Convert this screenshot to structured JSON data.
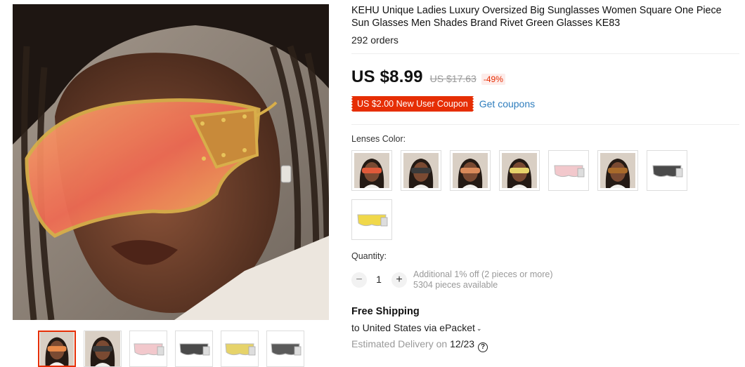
{
  "product": {
    "title": "KEHU Unique Ladies Luxury Oversized Big Sunglasses Women Square One Piece Sun Glasses Men Shades Brand Rivet Green Glasses KE83",
    "orders": "292 orders"
  },
  "price": {
    "current": "US $8.99",
    "original": "US $17.63",
    "discount": "-49%"
  },
  "coupon": {
    "label": "US $2.00 New User Coupon",
    "link": "Get coupons"
  },
  "lenses": {
    "label": "Lenses Color:",
    "options": [
      {
        "kind": "model",
        "lens": "#e05a3a"
      },
      {
        "kind": "model",
        "lens": "#3a3a3a"
      },
      {
        "kind": "model",
        "lens": "#d98a5a"
      },
      {
        "kind": "model",
        "lens": "#e6d36a"
      },
      {
        "kind": "product",
        "lens": "#f2c8cc"
      },
      {
        "kind": "model",
        "lens": "#a86a2a"
      },
      {
        "kind": "product",
        "lens": "#4a4a4a"
      },
      {
        "kind": "product",
        "lens": "#f0d84a"
      }
    ]
  },
  "quantity": {
    "label": "Quantity:",
    "value": "1",
    "minus": "−",
    "plus": "+",
    "note_line1": "Additional 1% off (2 pieces or more)",
    "note_line2": "5304 pieces available"
  },
  "shipping": {
    "title": "Free Shipping",
    "destination": "to United States via ePacket",
    "chevron": "⌄",
    "delivery_prefix": "Estimated Delivery on ",
    "delivery_date": "12/23",
    "help_glyph": "?"
  },
  "gallery": {
    "thumbs": [
      {
        "kind": "model",
        "lens": "#e88a4a"
      },
      {
        "kind": "model",
        "lens": "#3a3a3a"
      },
      {
        "kind": "product",
        "lens": "#f2c8cc"
      },
      {
        "kind": "product",
        "lens": "#4a4a4a"
      },
      {
        "kind": "product",
        "lens": "#e6d36a"
      },
      {
        "kind": "product",
        "lens": "#5a5a5a"
      }
    ]
  },
  "colors": {
    "accent": "#e62e04",
    "link": "#2e7dbd"
  }
}
